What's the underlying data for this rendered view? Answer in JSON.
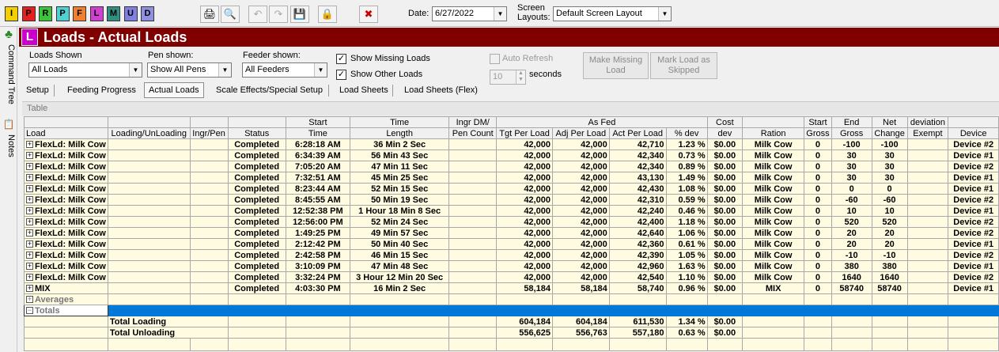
{
  "toolbar": {
    "modules": [
      {
        "letter": "I",
        "color": "#f2d000"
      },
      {
        "letter": "P",
        "color": "#e52020"
      },
      {
        "letter": "R",
        "color": "#3cc43c"
      },
      {
        "letter": "P",
        "color": "#50d0d0"
      },
      {
        "letter": "F",
        "color": "#f08030"
      },
      {
        "letter": "L",
        "color": "#d040d0"
      },
      {
        "letter": "M",
        "color": "#309080"
      },
      {
        "letter": "U",
        "color": "#8080e0"
      },
      {
        "letter": "D",
        "color": "#9090e0"
      }
    ],
    "date_label": "Date:",
    "date_value": "6/27/2022",
    "layouts_label_1": "Screen",
    "layouts_label_2": "Layouts:",
    "layout_value": "Default Screen Layout"
  },
  "side": {
    "command_tree": "Command Tree",
    "notes": "Notes"
  },
  "title": {
    "icon_letter": "L",
    "text": "Loads - Actual Loads"
  },
  "filters": {
    "loads_label": "Loads Shown",
    "loads_value": "All Loads",
    "pen_label": "Pen shown:",
    "pen_value": "Show All Pens",
    "feeder_label": "Feeder shown:",
    "feeder_value": "All Feeders",
    "show_missing": "Show Missing Loads",
    "show_other": "Show Other Loads",
    "auto_refresh": "Auto Refresh",
    "refresh_value": "10",
    "seconds": "seconds",
    "make_missing": "Make Missing Load",
    "mark_skipped": "Mark Load as Skipped"
  },
  "tabs": [
    "Setup",
    "Feeding Progress",
    "Actual Loads",
    "Scale Effects/Special Setup",
    "Load Sheets",
    "Load Sheets (Flex)"
  ],
  "table_label": "Table",
  "header_top": [
    "",
    "",
    "",
    "",
    "Start",
    "Time",
    "Ingr DM/",
    "As Fed",
    "Cost",
    "",
    "Start",
    "End",
    "Net",
    "deviation",
    ""
  ],
  "header_bottom": [
    "Load",
    "Loading/UnLoading",
    "Ingr/Pen",
    "Status",
    "Time",
    "Length",
    "Pen Count",
    "Tgt Per Load",
    "Adj Per Load",
    "Act Per Load",
    "% dev",
    "dev",
    "Ration",
    "Gross",
    "Gross",
    "Change",
    "Exempt",
    "Device"
  ],
  "rows": [
    [
      "FlexLd: Milk Cow",
      "Completed",
      "6:28:18 AM",
      "36 Min 2 Sec",
      "42,000",
      "42,000",
      "42,710",
      "1.23 %",
      "$0.00",
      "Milk Cow",
      "0",
      "-100",
      "-100",
      "Device #2"
    ],
    [
      "FlexLd: Milk Cow",
      "Completed",
      "6:34:39 AM",
      "56 Min 43 Sec",
      "42,000",
      "42,000",
      "42,340",
      "0.73 %",
      "$0.00",
      "Milk Cow",
      "0",
      "30",
      "30",
      "Device #1"
    ],
    [
      "FlexLd: Milk Cow",
      "Completed",
      "7:05:20 AM",
      "47 Min 11 Sec",
      "42,000",
      "42,000",
      "42,340",
      "0.89 %",
      "$0.00",
      "Milk Cow",
      "0",
      "30",
      "30",
      "Device #2"
    ],
    [
      "FlexLd: Milk Cow",
      "Completed",
      "7:32:51 AM",
      "45 Min 25 Sec",
      "42,000",
      "42,000",
      "43,130",
      "1.49 %",
      "$0.00",
      "Milk Cow",
      "0",
      "30",
      "30",
      "Device #1"
    ],
    [
      "FlexLd: Milk Cow",
      "Completed",
      "8:23:44 AM",
      "52 Min 15 Sec",
      "42,000",
      "42,000",
      "42,430",
      "1.08 %",
      "$0.00",
      "Milk Cow",
      "0",
      "0",
      "0",
      "Device #1"
    ],
    [
      "FlexLd: Milk Cow",
      "Completed",
      "8:45:55 AM",
      "50 Min 19 Sec",
      "42,000",
      "42,000",
      "42,310",
      "0.59 %",
      "$0.00",
      "Milk Cow",
      "0",
      "-60",
      "-60",
      "Device #2"
    ],
    [
      "FlexLd: Milk Cow",
      "Completed",
      "12:52:38 PM",
      "1 Hour 18 Min 8 Sec",
      "42,000",
      "42,000",
      "42,240",
      "0.46 %",
      "$0.00",
      "Milk Cow",
      "0",
      "10",
      "10",
      "Device #1"
    ],
    [
      "FlexLd: Milk Cow",
      "Completed",
      "12:56:00 PM",
      "52 Min 24 Sec",
      "42,000",
      "42,000",
      "42,400",
      "1.18 %",
      "$0.00",
      "Milk Cow",
      "0",
      "520",
      "520",
      "Device #2"
    ],
    [
      "FlexLd: Milk Cow",
      "Completed",
      "1:49:25 PM",
      "49 Min 57 Sec",
      "42,000",
      "42,000",
      "42,640",
      "1.06 %",
      "$0.00",
      "Milk Cow",
      "0",
      "20",
      "20",
      "Device #2"
    ],
    [
      "FlexLd: Milk Cow",
      "Completed",
      "2:12:42 PM",
      "50 Min 40 Sec",
      "42,000",
      "42,000",
      "42,360",
      "0.61 %",
      "$0.00",
      "Milk Cow",
      "0",
      "20",
      "20",
      "Device #1"
    ],
    [
      "FlexLd: Milk Cow",
      "Completed",
      "2:42:58 PM",
      "46 Min 15 Sec",
      "42,000",
      "42,000",
      "42,390",
      "1.05 %",
      "$0.00",
      "Milk Cow",
      "0",
      "-10",
      "-10",
      "Device #2"
    ],
    [
      "FlexLd: Milk Cow",
      "Completed",
      "3:10:09 PM",
      "47 Min 48 Sec",
      "42,000",
      "42,000",
      "42,960",
      "1.63 %",
      "$0.00",
      "Milk Cow",
      "0",
      "380",
      "380",
      "Device #1"
    ],
    [
      "FlexLd: Milk Cow",
      "Completed",
      "3:32:24 PM",
      "3 Hour 12 Min 20 Sec",
      "42,000",
      "42,000",
      "42,540",
      "1.10 %",
      "$0.00",
      "Milk Cow",
      "0",
      "1640",
      "1640",
      "Device #2"
    ],
    [
      "MIX",
      "Completed",
      "4:03:30 PM",
      "16 Min 2 Sec",
      "58,184",
      "58,184",
      "58,740",
      "0.96 %",
      "$0.00",
      "MIX",
      "0",
      "58740",
      "58740",
      "Device #1"
    ]
  ],
  "averages_label": "Averages",
  "totals_label": "Totals",
  "summary": [
    {
      "label": "Total Loading",
      "tgt": "604,184",
      "adj": "604,184",
      "act": "611,530",
      "dev": "1.34 %",
      "cost": "$0.00"
    },
    {
      "label": "Total Unloading",
      "tgt": "556,625",
      "adj": "556,763",
      "act": "557,180",
      "dev": "0.63 %",
      "cost": "$0.00"
    }
  ]
}
